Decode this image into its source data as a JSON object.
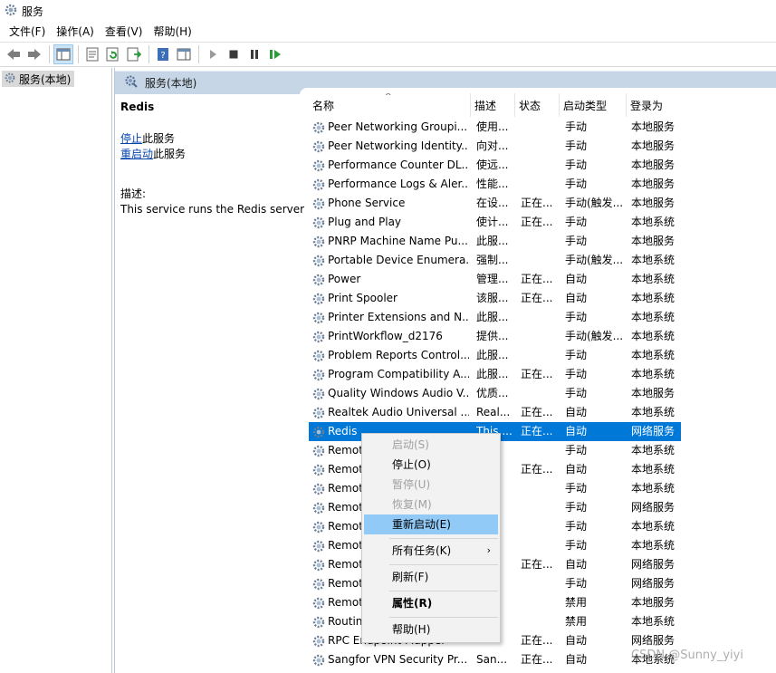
{
  "window": {
    "title": "服务"
  },
  "menu": [
    "文件(F)",
    "操作(A)",
    "查看(V)",
    "帮助(H)"
  ],
  "tree": {
    "item": "服务(本地)"
  },
  "content_header": "服务(本地)",
  "detail": {
    "service_name": "Redis",
    "stop_link": "停止",
    "stop_suffix": "此服务",
    "restart_link": "重启动",
    "restart_suffix": "此服务",
    "desc_label": "描述:",
    "desc_text": "This service runs the Redis server"
  },
  "columns": {
    "name": "名称",
    "desc": "描述",
    "status": "状态",
    "startup": "启动类型",
    "logon": "登录为"
  },
  "services": [
    {
      "name": "Peer Networking Groupi...",
      "desc": "使用...",
      "status": "",
      "startup": "手动",
      "logon": "本地服务"
    },
    {
      "name": "Peer Networking Identity...",
      "desc": "向对...",
      "status": "",
      "startup": "手动",
      "logon": "本地服务"
    },
    {
      "name": "Performance Counter DL...",
      "desc": "使远...",
      "status": "",
      "startup": "手动",
      "logon": "本地服务"
    },
    {
      "name": "Performance Logs & Aler...",
      "desc": "性能...",
      "status": "",
      "startup": "手动",
      "logon": "本地服务"
    },
    {
      "name": "Phone Service",
      "desc": "在设...",
      "status": "正在...",
      "startup": "手动(触发...",
      "logon": "本地服务"
    },
    {
      "name": "Plug and Play",
      "desc": "使计...",
      "status": "正在...",
      "startup": "手动",
      "logon": "本地系统"
    },
    {
      "name": "PNRP Machine Name Pu...",
      "desc": "此服...",
      "status": "",
      "startup": "手动",
      "logon": "本地服务"
    },
    {
      "name": "Portable Device Enumera...",
      "desc": "强制...",
      "status": "",
      "startup": "手动(触发...",
      "logon": "本地系统"
    },
    {
      "name": "Power",
      "desc": "管理...",
      "status": "正在...",
      "startup": "自动",
      "logon": "本地系统"
    },
    {
      "name": "Print Spooler",
      "desc": "该服...",
      "status": "正在...",
      "startup": "自动",
      "logon": "本地系统"
    },
    {
      "name": "Printer Extensions and N...",
      "desc": "此服...",
      "status": "",
      "startup": "手动",
      "logon": "本地系统"
    },
    {
      "name": "PrintWorkflow_d2176",
      "desc": "提供...",
      "status": "",
      "startup": "手动(触发...",
      "logon": "本地系统"
    },
    {
      "name": "Problem Reports Control...",
      "desc": "此服...",
      "status": "",
      "startup": "手动",
      "logon": "本地系统"
    },
    {
      "name": "Program Compatibility A...",
      "desc": "此服...",
      "status": "正在...",
      "startup": "手动",
      "logon": "本地系统"
    },
    {
      "name": "Quality Windows Audio V...",
      "desc": "优质...",
      "status": "",
      "startup": "手动",
      "logon": "本地服务"
    },
    {
      "name": "Realtek Audio Universal ...",
      "desc": "Real...",
      "status": "正在...",
      "startup": "自动",
      "logon": "本地系统"
    },
    {
      "name": "Redis",
      "desc": "This ...",
      "status": "正在...",
      "startup": "自动",
      "logon": "网络服务"
    },
    {
      "name": "Remot",
      "desc": "",
      "status": "",
      "startup": "手动",
      "logon": "本地系统"
    },
    {
      "name": "Remot",
      "desc": "",
      "status": "正在...",
      "startup": "自动",
      "logon": "本地系统"
    },
    {
      "name": "Remot",
      "desc": "",
      "status": "",
      "startup": "手动",
      "logon": "本地系统"
    },
    {
      "name": "Remot",
      "desc": "",
      "status": "",
      "startup": "手动",
      "logon": "网络服务"
    },
    {
      "name": "Remot",
      "desc": "",
      "status": "",
      "startup": "手动",
      "logon": "本地系统"
    },
    {
      "name": "Remot",
      "desc": "",
      "status": "",
      "startup": "手动",
      "logon": "本地系统"
    },
    {
      "name": "Remot",
      "desc": "",
      "status": "正在...",
      "startup": "自动",
      "logon": "网络服务"
    },
    {
      "name": "Remot",
      "desc": "",
      "status": "",
      "startup": "手动",
      "logon": "网络服务"
    },
    {
      "name": "Remot",
      "desc": "",
      "status": "",
      "startup": "禁用",
      "logon": "本地服务"
    },
    {
      "name": "Routin",
      "desc": "",
      "status": "",
      "startup": "禁用",
      "logon": "本地系统"
    },
    {
      "name": "RPC Endpoint Mapper",
      "desc": "",
      "status": "正在...",
      "startup": "自动",
      "logon": "网络服务"
    },
    {
      "name": "Sangfor VPN Security Pr...",
      "desc": "San...",
      "status": "正在...",
      "startup": "自动",
      "logon": "本地系统"
    }
  ],
  "context_menu": {
    "start": "启动(S)",
    "stop": "停止(O)",
    "pause": "暂停(U)",
    "resume": "恢复(M)",
    "restart": "重新启动(E)",
    "all_tasks": "所有任务(K)",
    "refresh": "刷新(F)",
    "properties": "属性(R)",
    "help": "帮助(H)"
  },
  "watermark": "CSDN @Sunny_yiyi",
  "colors": {
    "selection": "#0078d7",
    "menu_hover": "#91c9f7",
    "header_band": "#c6d6e6"
  }
}
